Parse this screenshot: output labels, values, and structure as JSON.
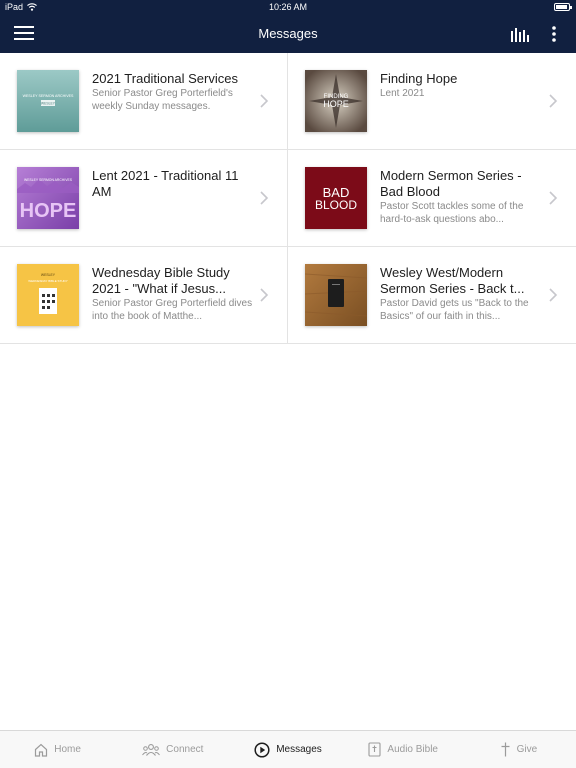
{
  "status_bar": {
    "device": "iPad",
    "time": "10:26 AM",
    "battery_level": 0.9
  },
  "nav": {
    "title": "Messages"
  },
  "series": [
    {
      "title": "2021 Traditional Services",
      "subtitle": "Senior Pastor Greg Porterfield's weekly Sunday messages.",
      "art_text": "WESLEY SERMON ARCHIVES",
      "art_sub": "WESLEY"
    },
    {
      "title": "Finding Hope",
      "subtitle": "Lent 2021",
      "art_text": "FINDING",
      "art_sub": "HOPE"
    },
    {
      "title": "Lent 2021 - Traditional 11 AM",
      "subtitle": "",
      "art_text": "WESLEY SERMON ARCHIVES",
      "art_sub": "HOPE"
    },
    {
      "title": "Modern Sermon Series - Bad Blood",
      "subtitle": "Pastor Scott tackles some of the hard-to-ask questions abo...",
      "art_text": "BAD",
      "art_sub": "BLOOD"
    },
    {
      "title": "Wednesday Bible Study 2021 - \"What if Jesus...",
      "subtitle": "Senior Pastor Greg Porterfield dives into the book of Matthe...",
      "art_text": "WESLEY",
      "art_sub": "WEDNESDAY BIBLE STUDY"
    },
    {
      "title": "Wesley West/Modern Sermon Series - Back t...",
      "subtitle": "Pastor David gets us \"Back to the Basics\" of our faith in this...",
      "art_text": "",
      "art_sub": ""
    }
  ],
  "tabs": [
    {
      "label": "Home",
      "icon": "home-icon",
      "active": false
    },
    {
      "label": "Connect",
      "icon": "people-icon",
      "active": false
    },
    {
      "label": "Messages",
      "icon": "play-circle-icon",
      "active": true
    },
    {
      "label": "Audio Bible",
      "icon": "bible-icon",
      "active": false
    },
    {
      "label": "Give",
      "icon": "cross-icon",
      "active": false
    }
  ],
  "colors": {
    "nav_background": "#112040",
    "tab_active": "#1e1e1e",
    "tab_inactive": "#9b9b9b",
    "divider": "#e3e3e3"
  }
}
